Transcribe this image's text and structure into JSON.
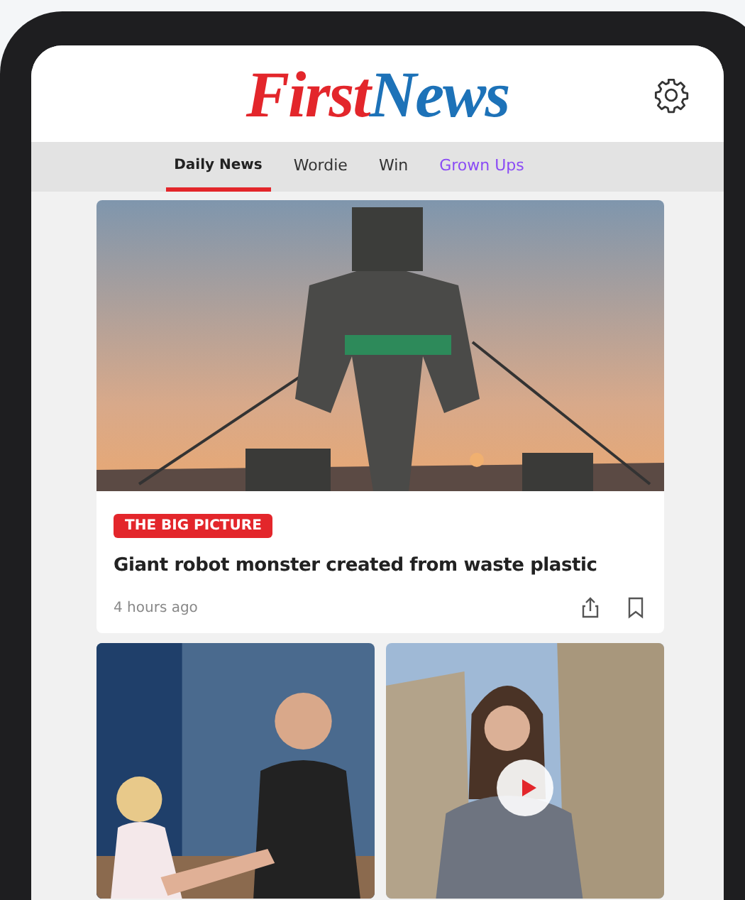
{
  "logo": {
    "parts": [
      {
        "text": "First",
        "color": "#e3262b"
      },
      {
        "text": "News",
        "color": "#1d72b8"
      }
    ]
  },
  "tabs": [
    {
      "label": "Daily News",
      "selected": true,
      "color": "#222222"
    },
    {
      "label": "Wordie",
      "selected": false,
      "color": "#333333"
    },
    {
      "label": "Win",
      "selected": false,
      "color": "#333333"
    },
    {
      "label": "Grown Ups",
      "selected": false,
      "color": "#8b4cf5"
    }
  ],
  "featured": {
    "tag": "THE BIG PICTURE",
    "headline": "Giant robot monster created from waste plastic",
    "time": "4 hours ago"
  },
  "tiles": [
    {
      "kind": "article"
    },
    {
      "kind": "video"
    }
  ]
}
